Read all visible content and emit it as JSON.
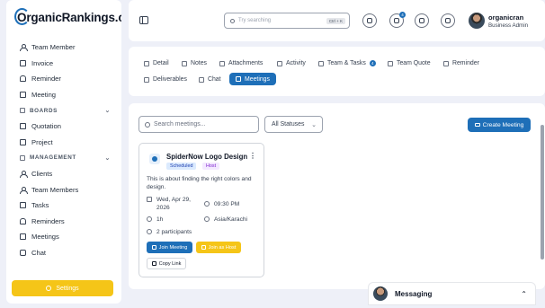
{
  "brand": {
    "logo_text": "rganicRankings.com",
    "logo_initial": "O"
  },
  "sidebar": {
    "items_top": [
      {
        "label": "Team Member",
        "icon": "person-icon"
      },
      {
        "label": "Invoice",
        "icon": "document-icon"
      },
      {
        "label": "Reminder",
        "icon": "bell-icon"
      },
      {
        "label": "Meeting",
        "icon": "video-icon"
      }
    ],
    "boards_section": "BOARDS",
    "items_boards": [
      {
        "label": "Quotation",
        "icon": "document-icon"
      },
      {
        "label": "Project",
        "icon": "folder-icon"
      }
    ],
    "management_section": "MANAGEMENT",
    "items_management": [
      {
        "label": "Clients",
        "icon": "person-icon"
      },
      {
        "label": "Team Members",
        "icon": "person-icon"
      },
      {
        "label": "Tasks",
        "icon": "check-icon"
      },
      {
        "label": "Reminders",
        "icon": "bell-icon"
      },
      {
        "label": "Meetings",
        "icon": "video-icon"
      },
      {
        "label": "Chat",
        "icon": "chat-icon"
      }
    ],
    "settings_label": "Settings"
  },
  "header": {
    "search_placeholder": "Try searching",
    "search_shortcut": "Ctrl + K",
    "notification_count": "4",
    "user_name": "organicran",
    "user_role": "Business Admin"
  },
  "tabs": [
    {
      "label": "Detail"
    },
    {
      "label": "Notes"
    },
    {
      "label": "Attachments"
    },
    {
      "label": "Activity"
    },
    {
      "label": "Team & Tasks",
      "count": "4"
    },
    {
      "label": "Team Quote"
    },
    {
      "label": "Reminder"
    },
    {
      "label": "Deliverables"
    },
    {
      "label": "Chat"
    },
    {
      "label": "Meetings",
      "active": true
    }
  ],
  "meetings": {
    "search_placeholder": "Search meetings...",
    "status_filter": "All Statuses",
    "create_label": "Create Meeting",
    "card": {
      "title": "SpiderNow Logo Design",
      "tag_status": "Scheduled",
      "tag_role": "Host",
      "description": "This is about finding the right colors and design.",
      "date": "Wed, Apr 29, 2026",
      "time": "09:30 PM",
      "duration": "1h",
      "timezone": "Asia/Karachi",
      "participants": "2 participants",
      "join_label": "Join Meeting",
      "host_label": "Join as Host",
      "copy_label": "Copy Link"
    }
  },
  "messaging": {
    "label": "Messaging"
  },
  "colors": {
    "primary": "#1e6fb8",
    "accent": "#f5c518",
    "background": "#eef0f8"
  }
}
